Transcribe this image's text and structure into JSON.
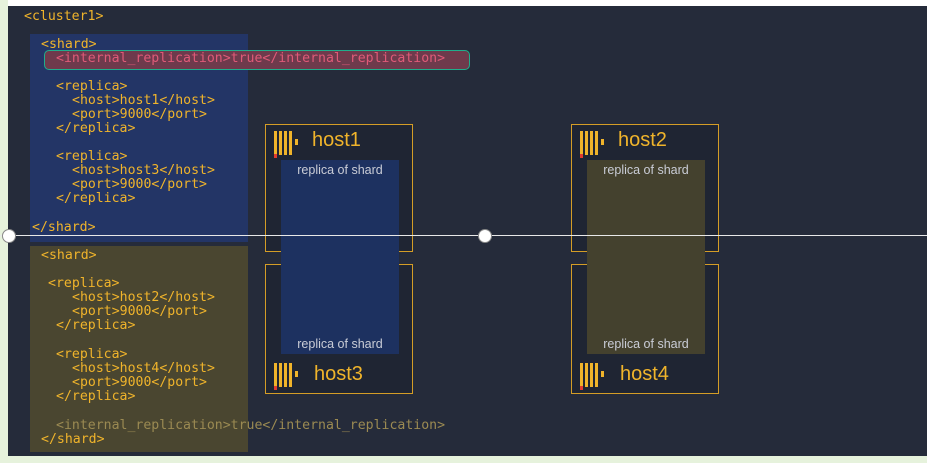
{
  "code": {
    "cluster_open": "<cluster1>",
    "shard_open": "<shard>",
    "shard_close": "</shard>",
    "internal_replication": "<internal_replication>true</internal_replication>",
    "replica_open": "<replica>",
    "replica_close": "</replica>",
    "shard1_replica1_host": "<host>host1</host>",
    "shard1_replica2_host": "<host>host3</host>",
    "shard2_replica1_host": "<host>host2</host>",
    "shard2_replica2_host": "<host>host4</host>",
    "port": "<port>9000</port>"
  },
  "hosts": {
    "host1": "host1",
    "host2": "host2",
    "host3": "host3",
    "host4": "host4"
  },
  "replica_label": "replica of shard",
  "colors": {
    "code_text": "#f0b42b",
    "shard1_bg": "#233566",
    "shard2_bg": "#4a4630",
    "highlight_border": "#1fae8c",
    "background": "#252b3a"
  }
}
